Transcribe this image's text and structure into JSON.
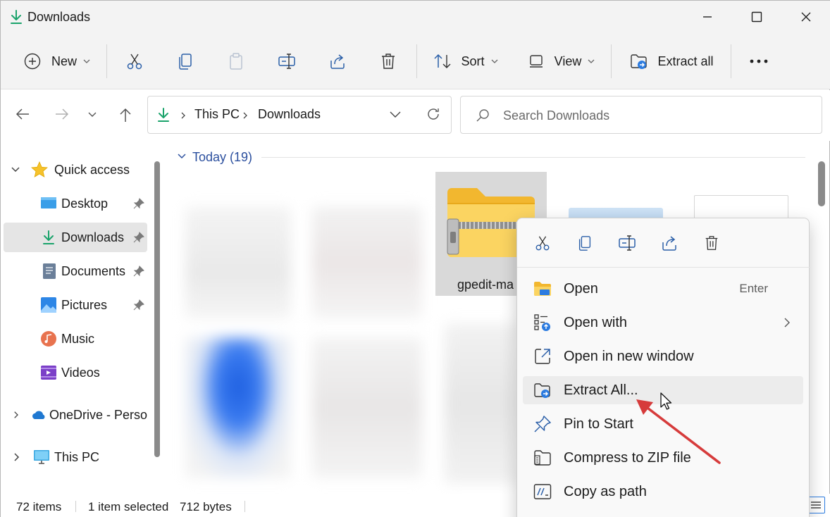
{
  "window": {
    "title": "Downloads",
    "icon": "download-arrow-icon"
  },
  "toolbar": {
    "new_label": "New",
    "sort_label": "Sort",
    "view_label": "View",
    "extract_all_label": "Extract all",
    "icons": [
      "new-plus-icon",
      "cut-icon",
      "copy-icon",
      "paste-icon",
      "rename-icon",
      "share-icon",
      "delete-icon",
      "sort-icon",
      "view-icon",
      "extract-all-icon",
      "more-icon"
    ]
  },
  "address": {
    "crumbs": [
      "This PC",
      "Downloads"
    ],
    "search_placeholder": "Search Downloads"
  },
  "sidebar": {
    "items": [
      {
        "label": "Quick access",
        "icon": "star-icon"
      },
      {
        "label": "Desktop",
        "icon": "desktop-icon",
        "pinned": true
      },
      {
        "label": "Downloads",
        "icon": "download-arrow-icon",
        "pinned": true,
        "selected": true
      },
      {
        "label": "Documents",
        "icon": "documents-icon",
        "pinned": true
      },
      {
        "label": "Pictures",
        "icon": "pictures-icon",
        "pinned": true
      },
      {
        "label": "Music",
        "icon": "music-icon"
      },
      {
        "label": "Videos",
        "icon": "videos-icon"
      },
      {
        "label": "OneDrive - Perso",
        "icon": "onedrive-icon"
      },
      {
        "label": "This PC",
        "icon": "this-pc-icon"
      }
    ]
  },
  "content": {
    "group_header": "Today (19)",
    "selected_file_name": "gpedit-ma"
  },
  "status": {
    "item_count": "72 items",
    "selection": "1 item selected",
    "size": "712 bytes"
  },
  "context_menu": {
    "top_icons": [
      "cut-icon",
      "copy-icon",
      "rename-icon",
      "share-icon",
      "delete-icon"
    ],
    "items": [
      {
        "label": "Open",
        "shortcut": "Enter",
        "icon": "open-folder-icon"
      },
      {
        "label": "Open with",
        "icon": "open-with-icon",
        "submenu": true
      },
      {
        "label": "Open in new window",
        "icon": "new-window-icon"
      },
      {
        "label": "Extract All...",
        "icon": "extract-all-icon",
        "hover": true
      },
      {
        "label": "Pin to Start",
        "icon": "pin-icon"
      },
      {
        "label": "Compress to ZIP file",
        "icon": "zip-icon"
      },
      {
        "label": "Copy as path",
        "icon": "copy-path-icon"
      }
    ]
  },
  "colors": {
    "accent": "#0f7ea8",
    "download_green": "#1aa36b",
    "folder_yellow": "#f7c94a",
    "group_header_blue": "#2b4f9e",
    "annotation_red": "#d63b3b"
  }
}
